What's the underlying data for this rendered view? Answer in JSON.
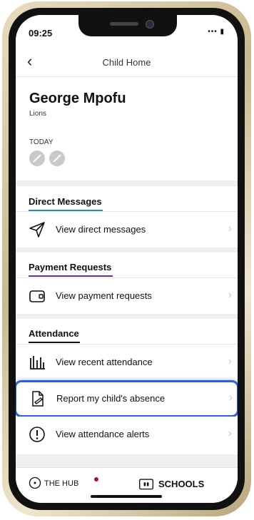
{
  "status_bar": {
    "time": "09:25",
    "signal": "••• ▮"
  },
  "header": {
    "title": "Child Home"
  },
  "profile": {
    "name": "George Mpofu",
    "class": "Lions",
    "today_label": "TODAY"
  },
  "sections": {
    "direct_messages": {
      "title": "Direct Messages",
      "accent": "#2e8fa0",
      "rows": [
        {
          "label": "View direct messages"
        }
      ]
    },
    "payment_requests": {
      "title": "Payment Requests",
      "accent": "#6a2fa0",
      "rows": [
        {
          "label": "View payment requests"
        }
      ]
    },
    "attendance": {
      "title": "Attendance",
      "accent": "#111111",
      "rows": [
        {
          "label": "View recent attendance"
        },
        {
          "label": "Report my child's absence"
        },
        {
          "label": "View attendance alerts"
        }
      ]
    }
  },
  "tabbar": {
    "hub_label": "THE HUB",
    "schools_label": "SCHOOLS",
    "badge_color": "#b0102a"
  },
  "colors": {
    "highlight": "#2f5fe0"
  },
  "icons": {
    "back": "chevron-left-icon",
    "messages": "paper-plane-icon",
    "payments": "wallet-icon",
    "attendance": "bar-chart-icon",
    "absence": "edit-document-icon",
    "alerts": "exclamation-circle-icon",
    "hub": "circle-dot-icon",
    "schools": "school-icon"
  }
}
